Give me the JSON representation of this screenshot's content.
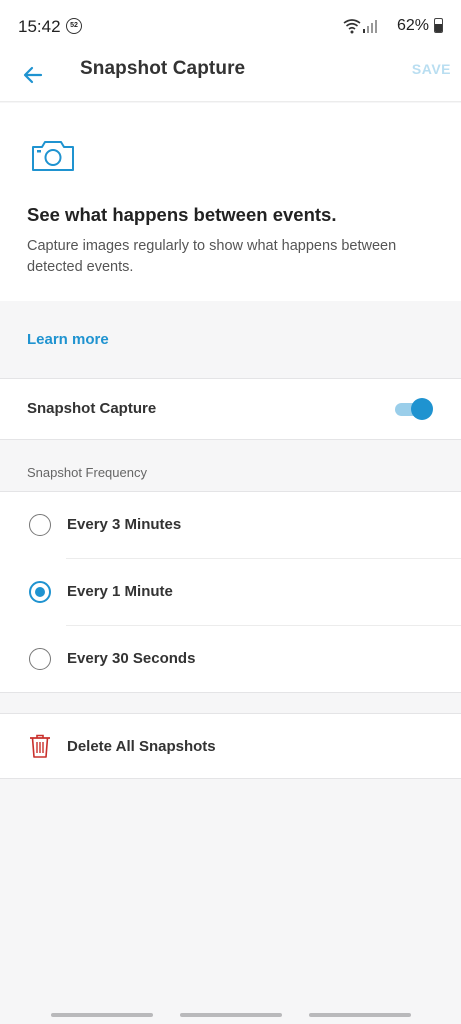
{
  "status_bar": {
    "time": "15:42",
    "notification_badge": "52",
    "battery_percent": "62%",
    "battery_level": 0.62
  },
  "header": {
    "back_icon": "arrow-left-icon",
    "title": "Snapshot Capture",
    "save_label": "SAVE",
    "save_enabled": false
  },
  "intro": {
    "icon": "camera-icon",
    "heading": "See what happens between events.",
    "body": "Capture images regularly to show what happens between detected events."
  },
  "learn_more": {
    "label": "Learn more"
  },
  "snapshot_toggle": {
    "label": "Snapshot Capture",
    "enabled": true
  },
  "frequency": {
    "section_label": "Snapshot Frequency",
    "options": [
      {
        "label": "Every 3 Minutes",
        "selected": false
      },
      {
        "label": "Every 1 Minute",
        "selected": true
      },
      {
        "label": "Every 30 Seconds",
        "selected": false
      }
    ]
  },
  "delete": {
    "icon": "trash-icon",
    "label": "Delete All Snapshots"
  },
  "colors": {
    "accent": "#1f93d0",
    "save_disabled": "#b9def1",
    "danger": "#c9302c",
    "background": "#f6f6f7",
    "card": "#ffffff"
  }
}
